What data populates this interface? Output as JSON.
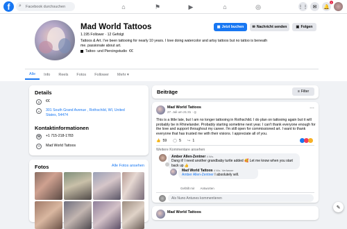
{
  "topbar": {
    "logo": "f",
    "search_placeholder": "Facebook durchsuchen",
    "notification_count": "1",
    "nav_icons": [
      "home-icon",
      "flag-icon",
      "video-icon",
      "marketplace-icon",
      "gaming-icon"
    ]
  },
  "profile": {
    "name": "Mad World Tattoos",
    "followers": "1.195 Follower · 12 Gefolgt",
    "bio": "Tattoos & Art. I've been tattooing for nearly 10 years. I love doing watercolor and artsy tattoos but no tattoo is beneath me. passionate about art.",
    "category": "Tattoo- und Piercingstudio",
    "price": "€€"
  },
  "buttons": {
    "book": "Jetzt buchen",
    "message": "Nachricht senden",
    "follow": "Folgen"
  },
  "tabs": [
    "Alle",
    "Info",
    "Reels",
    "Fotos",
    "Follower",
    "Mehr ▾"
  ],
  "details": {
    "title": "Details",
    "price": "€€",
    "address_line1": "301 South Grand Avenue , Rothschild, WI, United",
    "address_line2": "States, 54474",
    "contact_title": "Kontaktinformationen",
    "phone": "+1 715-218-1783",
    "messenger": "Mad World Tattoos"
  },
  "photos": {
    "title": "Fotos",
    "all_link": "Alle Fotos ansehen"
  },
  "posts": {
    "title": "Beiträge",
    "filter": "Filter",
    "post": {
      "author": "Mad World Tattoos",
      "time": "27. Juli um 21:31 · ",
      "text": "This is a little late, but I am no longer tattooing in Rothschild. I do plan on tattooing again but it will probably be in Rhinelander. Probably starting sometime next year. I can't thank everyone enough for the love and support throughout my career. I'm still open for commissioned art. I want to thank everyone that has trusted me with their visions. I appreciate all of you.",
      "reactions": "59",
      "comments": "5",
      "shares": "1",
      "more_comments": "Weitere Kommentare ansehen",
      "comment1_author": "Amber Allen-Zentner",
      "comment1_time": "4 Wo.",
      "comment1_text": "Dang it! I need another grandbaby turtle added 🥰 Let me know when you start back up 👍",
      "like1": "Gefällt mir",
      "reply1": "Antworten",
      "reply_author": "Mad World Tattoos",
      "reply_time": "4 Wo.",
      "reply_tag": "Verfasser",
      "reply_mention": "Amber Allen-Zentner",
      "reply_text": " I absolutely will.",
      "like2": "Gefällt mir",
      "reply2": "Antworten",
      "comment_placeholder": "Als Nuno Antunes kommentieren"
    },
    "post2_author": "Mad World Tattoos"
  },
  "colors": {
    "accent": "#1877f2",
    "bg": "#f0f2f5",
    "badge": "#e41e3f"
  }
}
